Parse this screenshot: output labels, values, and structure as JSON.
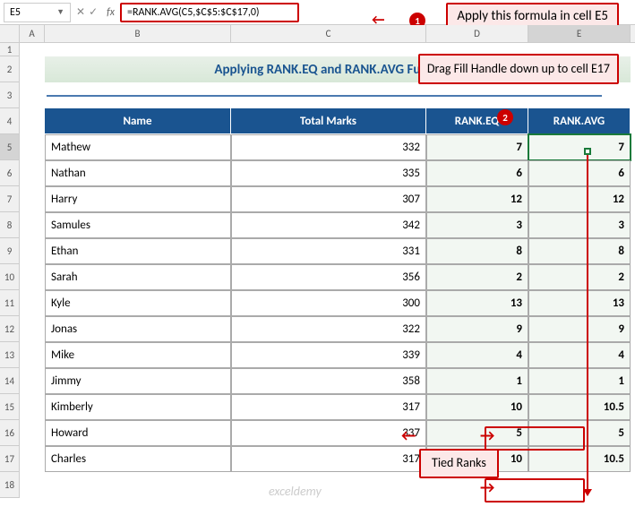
{
  "cellRef": "E5",
  "formula": "=RANK.AVG(C5,$C$5:$C$17,0)",
  "callout1": "Apply this formula in cell E5",
  "callout2": "Drag Fill Handle down up to cell E17",
  "tiedLabel": "Tied Ranks",
  "title": "Applying RANK.EQ and RANK.AVG Functions",
  "watermark": "exceldemy",
  "cols": [
    "A",
    "B",
    "C",
    "D",
    "E"
  ],
  "rowNums": [
    "1",
    "2",
    "3",
    "4",
    "5",
    "6",
    "7",
    "8",
    "9",
    "10",
    "11",
    "12",
    "13",
    "14",
    "15",
    "16",
    "17",
    "18"
  ],
  "headers": {
    "name": "Name",
    "marks": "Total Marks",
    "eq": "RANK.EQ",
    "avg": "RANK.AVG"
  },
  "rows": [
    {
      "name": "Mathew",
      "marks": 332,
      "eq": 7,
      "avg": "7"
    },
    {
      "name": "Nathan",
      "marks": 335,
      "eq": 6,
      "avg": "6"
    },
    {
      "name": "Harry",
      "marks": 307,
      "eq": 12,
      "avg": "12"
    },
    {
      "name": "Samules",
      "marks": 342,
      "eq": 3,
      "avg": "3"
    },
    {
      "name": "Ethan",
      "marks": 331,
      "eq": 8,
      "avg": "8"
    },
    {
      "name": "Sarah",
      "marks": 356,
      "eq": 2,
      "avg": "2"
    },
    {
      "name": "Kyle",
      "marks": 300,
      "eq": 13,
      "avg": "13"
    },
    {
      "name": "Jonas",
      "marks": 322,
      "eq": 9,
      "avg": "9"
    },
    {
      "name": "Mike",
      "marks": 339,
      "eq": 4,
      "avg": "4"
    },
    {
      "name": "Jimmy",
      "marks": 358,
      "eq": 1,
      "avg": "1"
    },
    {
      "name": "Kimberly",
      "marks": 317,
      "eq": 10,
      "avg": "10.5"
    },
    {
      "name": "Howard",
      "marks": 337,
      "eq": 5,
      "avg": "5"
    },
    {
      "name": "Charles",
      "marks": 317,
      "eq": 10,
      "avg": "10.5"
    }
  ]
}
